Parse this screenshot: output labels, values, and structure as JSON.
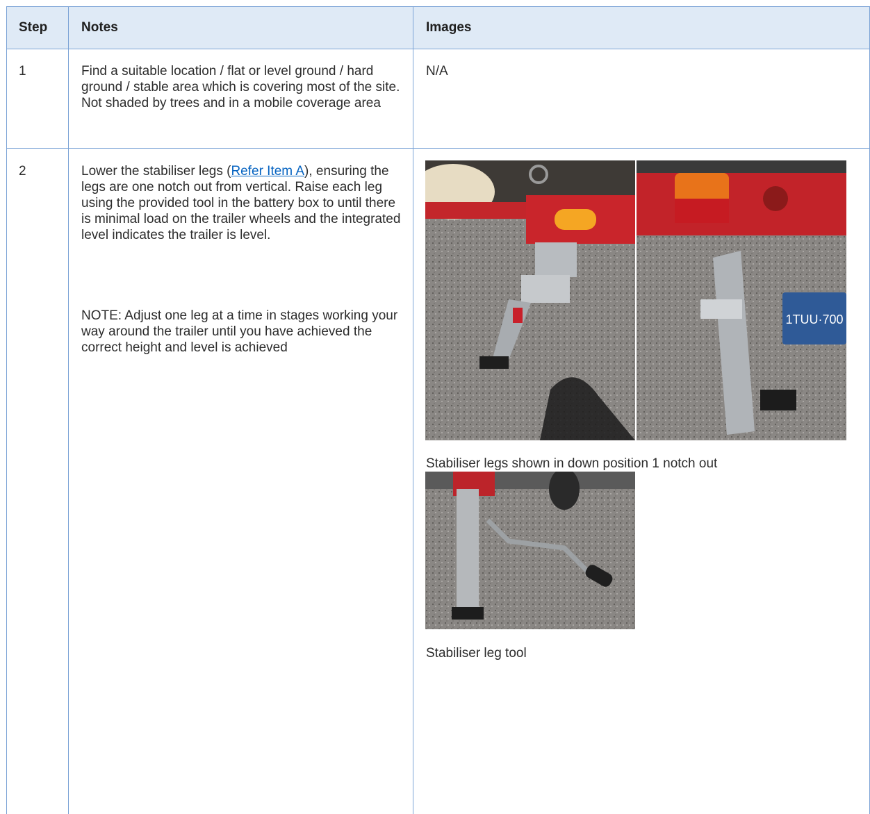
{
  "headers": {
    "step": "Step",
    "notes": "Notes",
    "images": "Images"
  },
  "rows": [
    {
      "step": "1",
      "notes": "Find a suitable location / flat or level ground / hard ground / stable area which is covering most of the site. Not shaded by trees and in a mobile coverage area",
      "images_text": "N/A"
    },
    {
      "step": "2",
      "notes_before_link": "Lower the stabiliser legs (",
      "notes_link": "Refer Item A",
      "notes_after_link": "), ensuring the legs are one notch out from vertical. Raise each leg using the provided tool in the battery box to until there is minimal load on the trailer wheels and the integrated level indicates the trailer is level.",
      "note2": "NOTE: Adjust one leg at a time in stages working your way around the trailer until you have achieved the correct height and level is achieved",
      "caption1": "Stabiliser legs shown in down position 1 notch out",
      "caption2": "Stabiliser leg tool",
      "plate_text": "1TUU·700"
    }
  ],
  "colors": {
    "border": "#7ba3d6",
    "header_bg": "#dfeaf6",
    "link": "#0563c1"
  }
}
